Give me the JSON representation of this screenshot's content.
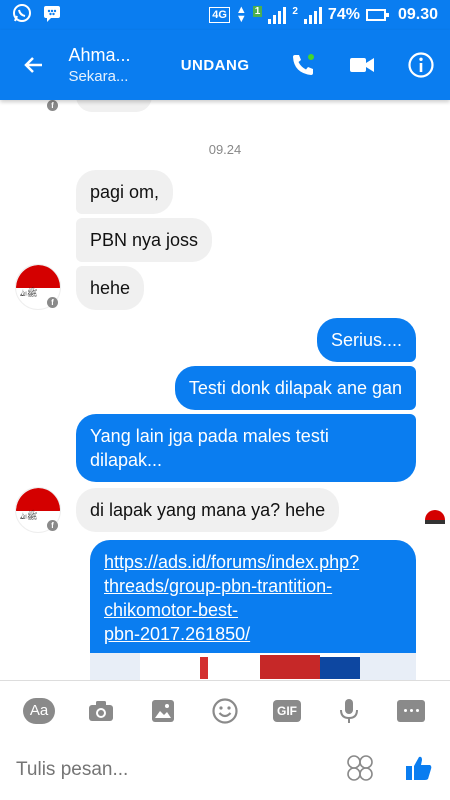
{
  "status_bar": {
    "network": "4G",
    "sim1": "1",
    "sim2": "2",
    "battery_percent": "74%",
    "time": "09.30"
  },
  "header": {
    "contact_name": "Ahma...",
    "status": "Sekara...",
    "invite_label": "UNDANG",
    "accent_color": "#0a7df0"
  },
  "chat": {
    "timestamp": "09.24",
    "avatar_text": "ﷺﷲ",
    "messages": [
      {
        "from": "them",
        "text": "pagi om,"
      },
      {
        "from": "them",
        "text": "PBN nya joss"
      },
      {
        "from": "them",
        "text": "hehe"
      },
      {
        "from": "me",
        "text": "Serius...."
      },
      {
        "from": "me",
        "text": "Testi donk dilapak ane gan"
      },
      {
        "from": "me",
        "text": "Yang lain jga pada males testi dilapak..."
      },
      {
        "from": "them",
        "text": "di lapak yang mana ya? hehe"
      },
      {
        "from": "me",
        "text": "https://ads.id/forums/index.php?threads/group-pbn-trantition-chikomotor-best-pbn-2017.261850/"
      }
    ],
    "link_lines": [
      "https://ads.id/forums/index.php?",
      "threads/group-pbn-trantition-",
      "chikomotor-best-",
      "pbn-2017.261850/"
    ],
    "out_msg3_lines": [
      "Yang lain jga pada males testi",
      "dilapak..."
    ]
  },
  "toolbar": {
    "aa_label": "Aa",
    "gif_label": "GIF"
  },
  "composer": {
    "placeholder": "Tulis pesan..."
  }
}
